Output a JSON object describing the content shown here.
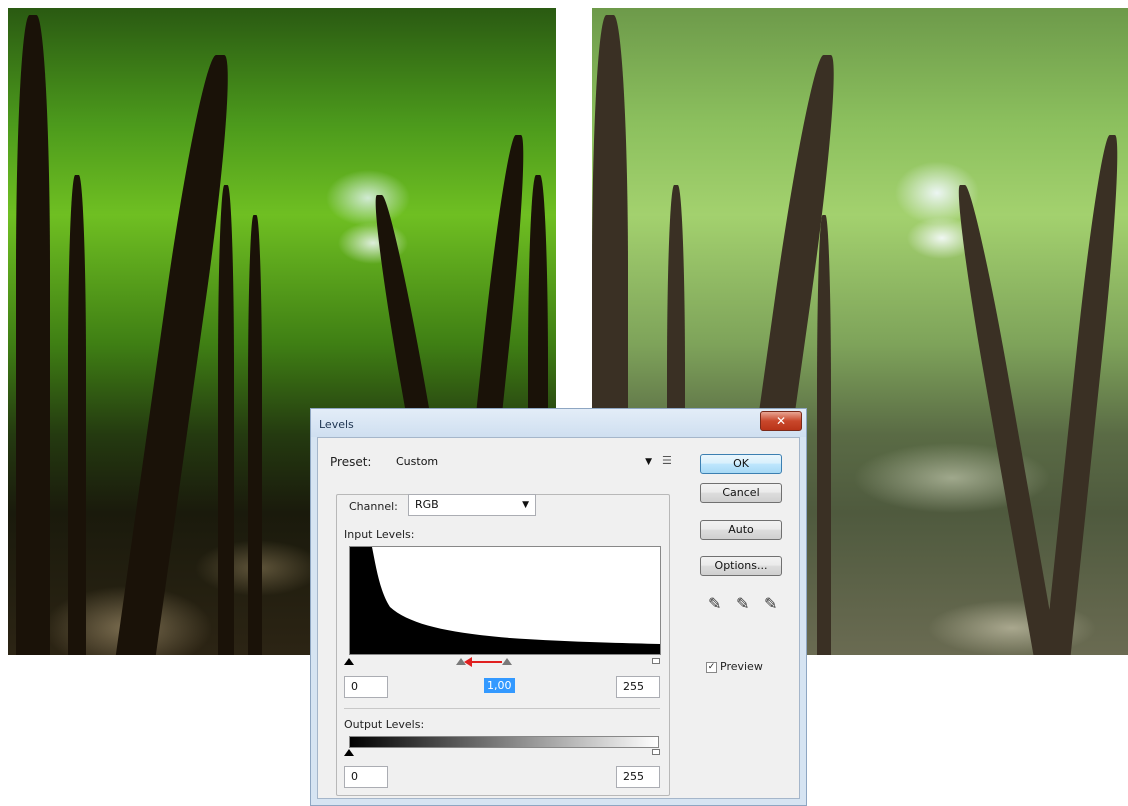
{
  "dialog": {
    "title": "Levels",
    "close_label": "✕",
    "preset_label": "Preset:",
    "preset_value": "Custom",
    "channel_label": "Channel:",
    "channel_value": "RGB",
    "input_levels_label": "Input Levels:",
    "input_black": "0",
    "input_gamma": "1,00",
    "input_white": "255",
    "output_levels_label": "Output Levels:",
    "output_black": "0",
    "output_white": "255",
    "buttons": {
      "ok": "OK",
      "cancel": "Cancel",
      "auto": "Auto",
      "options": "Options..."
    },
    "preview_label": "Preview",
    "preview_checked": true
  },
  "icons": {
    "preset_menu": "preset-options-icon",
    "eyedroppers": [
      "black-point-eyedropper-icon",
      "gray-point-eyedropper-icon",
      "white-point-eyedropper-icon"
    ],
    "gamma_arrow": "red-left-arrow-icon"
  },
  "colors": {
    "dialog_frame": "#d6e4f2",
    "ok_highlight": "#a7d9f5",
    "close_button": "#c9472b",
    "arrow": "#e02020"
  }
}
